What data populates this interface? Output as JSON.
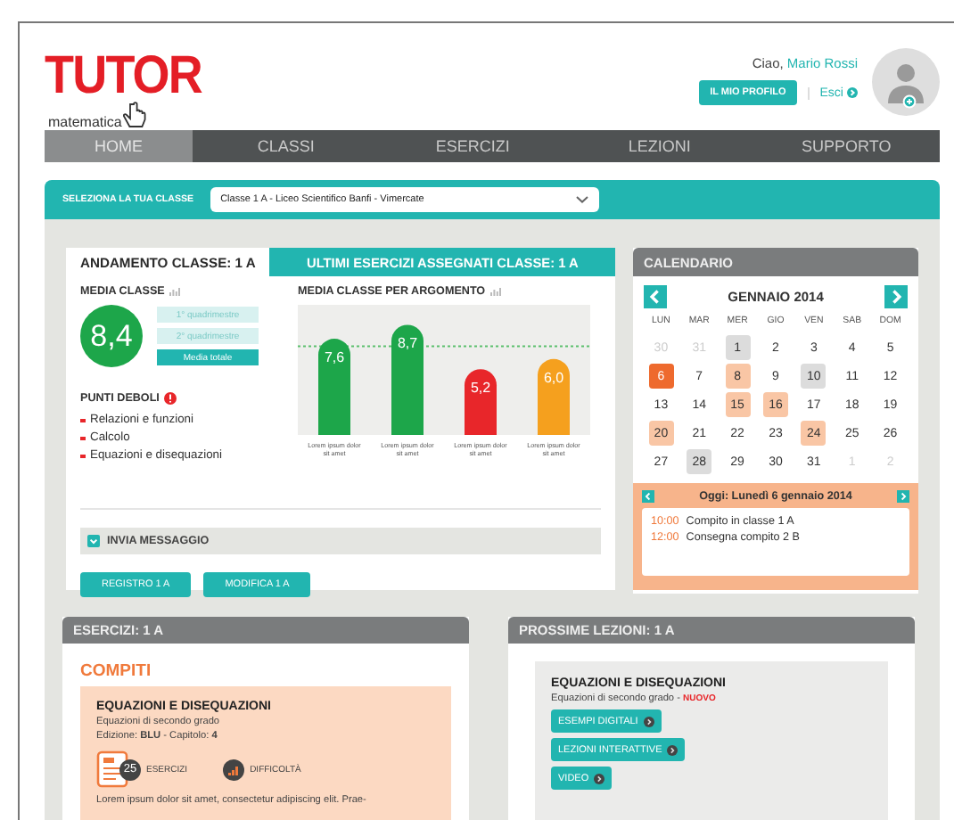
{
  "logo": {
    "title": "TUTOR",
    "subtitle": "matematica"
  },
  "user": {
    "greeting": "Ciao,",
    "name": "Mario Rossi",
    "profile_button": "IL MIO PROFILO",
    "logout": "Esci"
  },
  "nav": [
    {
      "label": "HOME",
      "selected": true
    },
    {
      "label": "CLASSI",
      "selected": false
    },
    {
      "label": "ESERCIZI",
      "selected": false
    },
    {
      "label": "LEZIONI",
      "selected": false
    },
    {
      "label": "SUPPORTO",
      "selected": false
    }
  ],
  "class_selector": {
    "label": "SELEZIONA LA TUA CLASSE",
    "value": "Classe 1 A - Liceo Scientifico Banfi - Vimercate"
  },
  "trend_card": {
    "tabs": [
      {
        "label": "ANDAMENTO CLASSE: 1 A",
        "selected": true
      },
      {
        "label": "ULTIMI ESERCIZI ASSEGNATI CLASSE: 1 A",
        "selected": false
      }
    ],
    "average": {
      "title": "MEDIA CLASSE",
      "value": "8,4",
      "periods": [
        {
          "label": "1° quadrimestre",
          "selected": false
        },
        {
          "label": "2° quadrimestre",
          "selected": false
        },
        {
          "label": "Media totale",
          "selected": true
        }
      ]
    },
    "weak_points": {
      "title": "PUNTI DEBOLI",
      "items": [
        "Relazioni e funzioni",
        "Calcolo",
        "Equazioni e disequazioni"
      ]
    },
    "topic_chart": {
      "title": "MEDIA CLASSE PER ARGOMENTO",
      "chart_data": {
        "type": "bar",
        "categories": [
          "Lorem ipsum dolor sit amet",
          "Lorem ipsum dolor sit amet",
          "Lorem ipsum dolor sit amet",
          "Lorem ipsum dolor sit amet"
        ],
        "values": [
          7.6,
          8.7,
          5.2,
          6.0
        ],
        "colors": [
          "#1da64a",
          "#1da64a",
          "#e8262a",
          "#f5a01e"
        ],
        "value_labels": [
          "7,6",
          "8,7",
          "5,2",
          "6,0"
        ],
        "ylim": [
          0,
          10
        ],
        "ref_lines": [
          {
            "axis": "y",
            "value": 7
          }
        ]
      }
    },
    "message_bar": "INVIA MESSAGGIO",
    "buttons": [
      "REGISTRO 1 A",
      "MODIFICA 1 A"
    ]
  },
  "calendar": {
    "title": "CALENDARIO",
    "month": "GENNAIO 2014",
    "weekdays": [
      "LUN",
      "MAR",
      "MER",
      "GIO",
      "VEN",
      "SAB",
      "DOM"
    ],
    "days": [
      {
        "label": "30",
        "kind": "other"
      },
      {
        "label": "31",
        "kind": "other"
      },
      {
        "label": "1",
        "kind": "marked"
      },
      {
        "label": "2",
        "kind": "plain"
      },
      {
        "label": "3",
        "kind": "plain"
      },
      {
        "label": "4",
        "kind": "plain"
      },
      {
        "label": "5",
        "kind": "plain"
      },
      {
        "label": "6",
        "kind": "today"
      },
      {
        "label": "7",
        "kind": "plain"
      },
      {
        "label": "8",
        "kind": "event"
      },
      {
        "label": "9",
        "kind": "plain"
      },
      {
        "label": "10",
        "kind": "marked"
      },
      {
        "label": "11",
        "kind": "plain"
      },
      {
        "label": "12",
        "kind": "plain"
      },
      {
        "label": "13",
        "kind": "plain"
      },
      {
        "label": "14",
        "kind": "plain"
      },
      {
        "label": "15",
        "kind": "event"
      },
      {
        "label": "16",
        "kind": "event"
      },
      {
        "label": "17",
        "kind": "plain"
      },
      {
        "label": "18",
        "kind": "plain"
      },
      {
        "label": "19",
        "kind": "plain"
      },
      {
        "label": "20",
        "kind": "event"
      },
      {
        "label": "21",
        "kind": "plain"
      },
      {
        "label": "22",
        "kind": "plain"
      },
      {
        "label": "23",
        "kind": "plain"
      },
      {
        "label": "24",
        "kind": "event"
      },
      {
        "label": "25",
        "kind": "plain"
      },
      {
        "label": "26",
        "kind": "plain"
      },
      {
        "label": "27",
        "kind": "plain"
      },
      {
        "label": "28",
        "kind": "marked"
      },
      {
        "label": "29",
        "kind": "plain"
      },
      {
        "label": "30",
        "kind": "plain"
      },
      {
        "label": "31",
        "kind": "plain"
      },
      {
        "label": "1",
        "kind": "other"
      },
      {
        "label": "2",
        "kind": "other"
      }
    ],
    "today": {
      "title": "Oggi: Lunedì 6 gennaio 2014",
      "events": [
        {
          "time": "10:00",
          "text": "Compito in classe 1 A"
        },
        {
          "time": "12:00",
          "text": "Consegna compito 2 B"
        }
      ]
    }
  },
  "exercises": {
    "title": "ESERCIZI: 1 A",
    "section": "COMPITI",
    "item": {
      "title": "EQUAZIONI E DISEQUAZIONI",
      "subtitle": "Equazioni di secondo grado",
      "edition": "Edizione: **BLU**  -  Capitolo: **4**",
      "count": "25",
      "count_label": "ESERCIZI",
      "difficulty_label": "DIFFICOLTÀ",
      "description": "Lorem ipsum dolor sit amet, consectetur adipiscing elit. Prae-"
    }
  },
  "lessons": {
    "title": "PROSSIME LEZIONI: 1 A",
    "item": {
      "title": "EQUAZIONI E DISEQUAZIONI",
      "subtitle": "Equazioni di secondo grado -",
      "badge": "NUOVO",
      "links": [
        "ESEMPI DIGITALI",
        "LEZIONI INTERATTIVE",
        "VIDEO"
      ]
    }
  }
}
